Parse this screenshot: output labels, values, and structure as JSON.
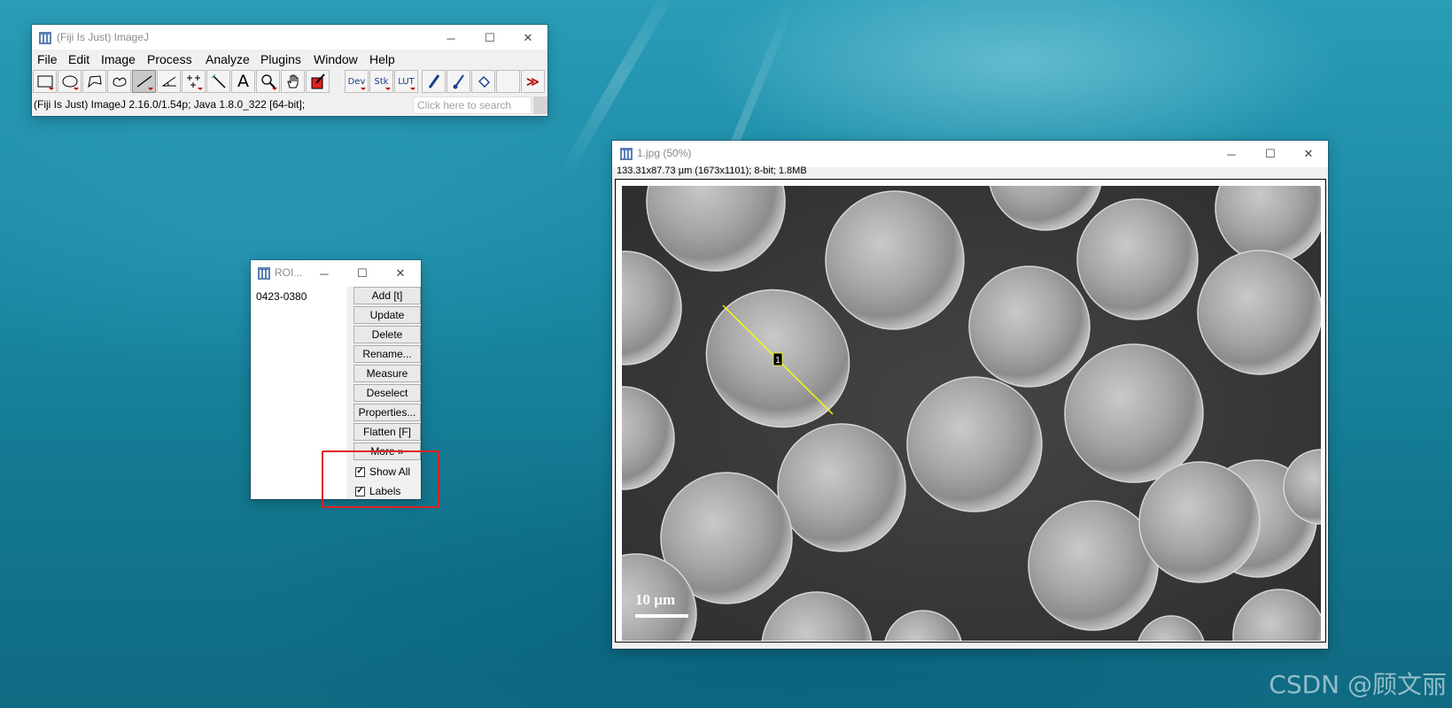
{
  "imagej": {
    "title": "(Fiji Is Just) ImageJ",
    "menus": [
      "File",
      "Edit",
      "Image",
      "Process",
      "Analyze",
      "Plugins",
      "Window",
      "Help"
    ],
    "tools": {
      "dev": "Dev",
      "stk": "Stk",
      "lut": "LUT",
      "text_tool": "A",
      "more": "≫"
    },
    "status": "(Fiji Is Just) ImageJ 2.16.0/1.54p; Java 1.8.0_322 [64-bit];",
    "search_placeholder": "Click here to search"
  },
  "roi_manager": {
    "title": "ROI...",
    "items": [
      "0423-0380"
    ],
    "buttons": [
      "Add [t]",
      "Update",
      "Delete",
      "Rename...",
      "Measure",
      "Deselect",
      "Properties...",
      "Flatten [F]",
      "More »"
    ],
    "show_all": {
      "label": "Show All",
      "checked": true
    },
    "labels": {
      "label": "Labels",
      "checked": true
    }
  },
  "image_window": {
    "title": "1.jpg (50%)",
    "info": "133.31x87.73 µm (1673x1101); 8-bit; 1.8MB",
    "roi_label": "1",
    "scale_bar": "10 µm",
    "line_roi_color": "#ffff00"
  },
  "window_controls": {
    "minimize": "─",
    "maximize": "☐",
    "close": "✕"
  },
  "watermark": "CSDN @顾文丽"
}
